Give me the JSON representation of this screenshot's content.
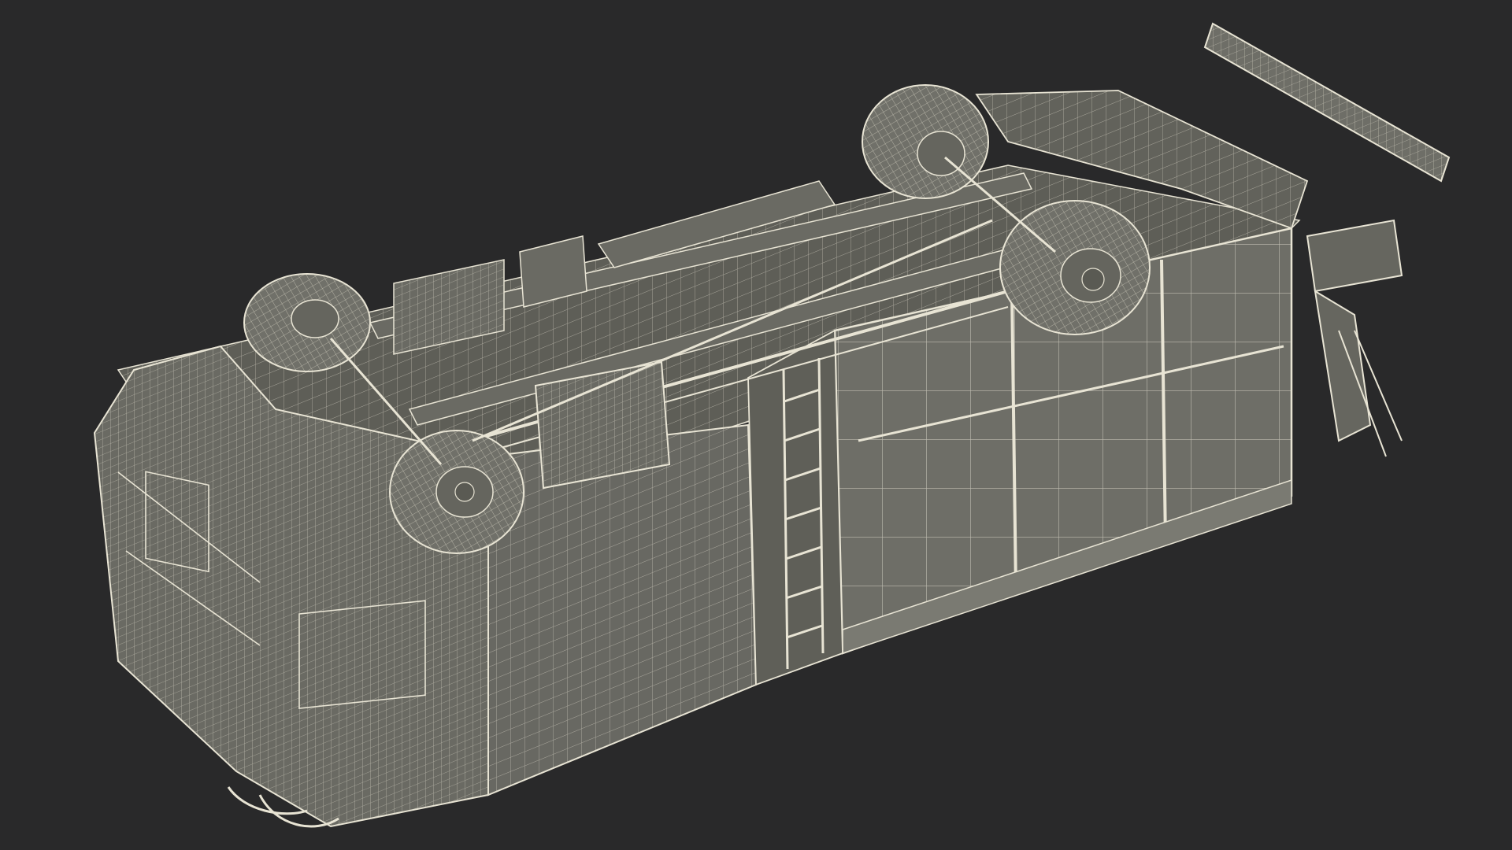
{
  "scene": {
    "background_color": "#29292a",
    "model_fill": "#6b6b64",
    "model_fill_dark": "#595952",
    "model_fill_light": "#7a7a72",
    "wire_color": "#e8e4d4",
    "wire_color_soft": "#cfcbbd",
    "tire_fill": "#707069"
  }
}
